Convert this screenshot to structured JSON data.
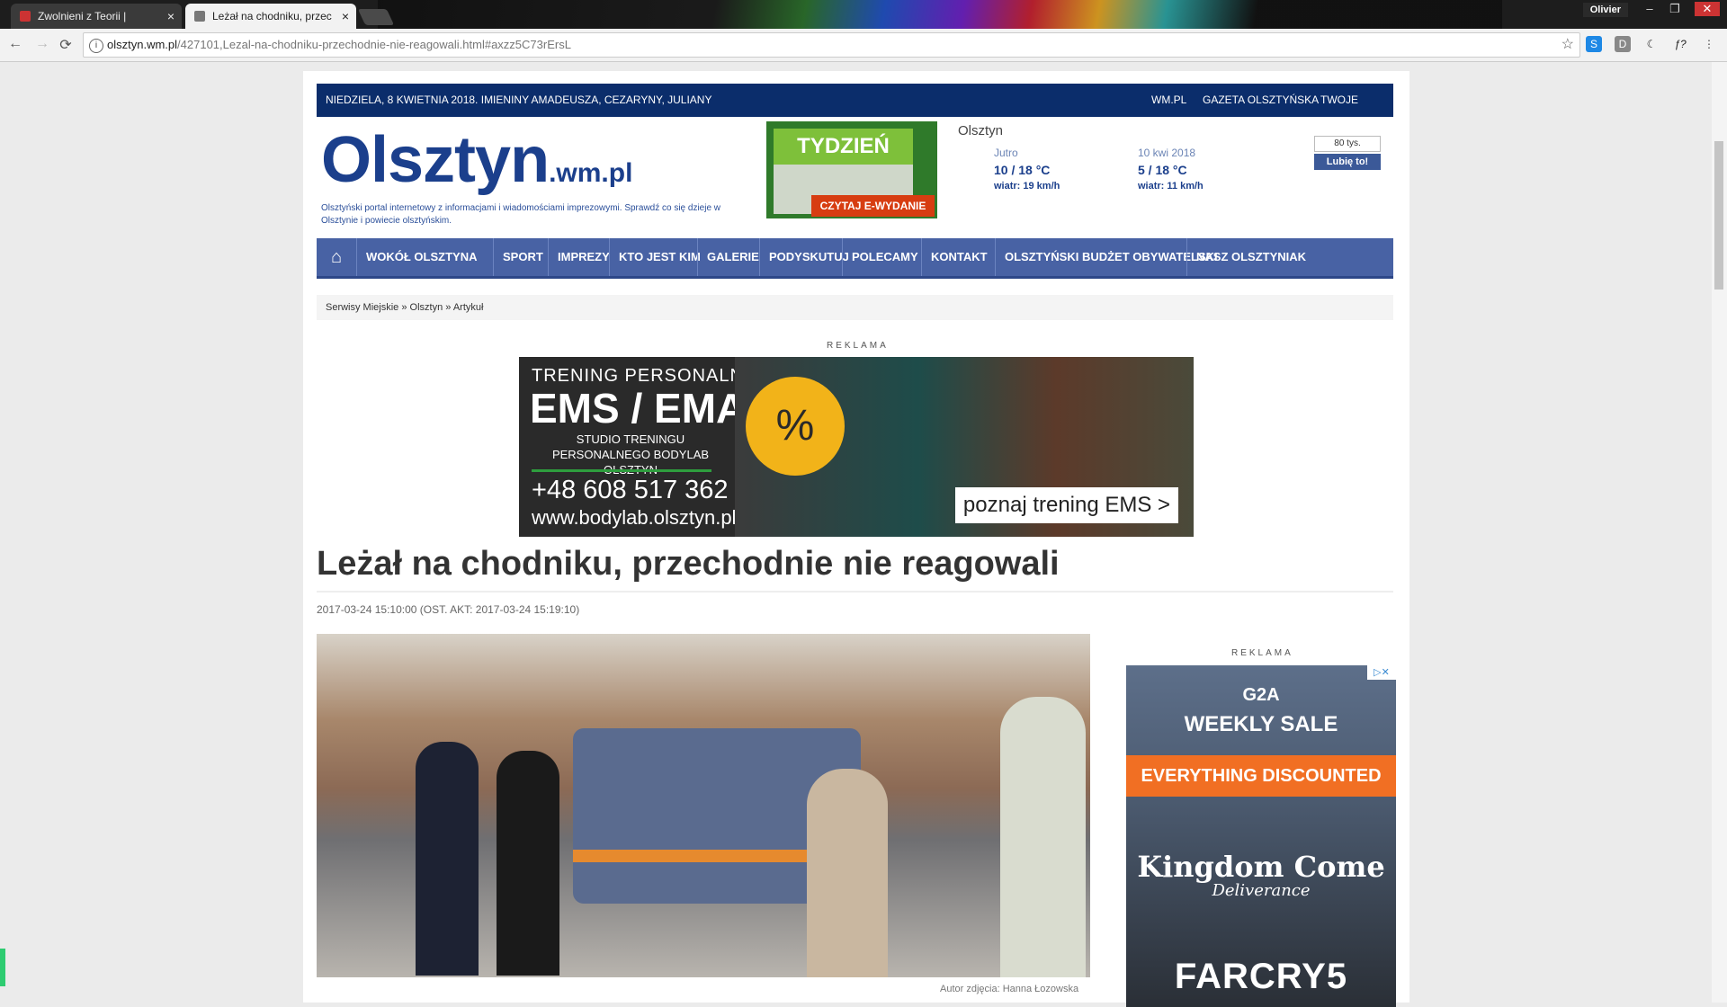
{
  "browser": {
    "tabs": [
      {
        "title": "Zwolnieni z Teorii |",
        "close": "×"
      },
      {
        "title": "Leżał na chodniku, przec",
        "close": "×"
      }
    ],
    "user": "Olivier",
    "window_controls": [
      "–",
      "❐",
      "✕"
    ],
    "url_host": "olsztyn.wm.pl",
    "url_path": "/427101,Lezal-na-chodniku-przechodnie-nie-reagowali.html#axzz5C73rErsL",
    "info_icon": "i",
    "back": "←",
    "forward": "→",
    "reload": "⟳",
    "star": "☆",
    "extensions": [
      "S",
      "D",
      "☾",
      "ƒ?",
      "⋮"
    ]
  },
  "site": {
    "date_line": "NIEDZIELA, 8 KWIETNIA 2018. IMIENINY AMADEUSZA, CEZARYNY, JULIANY",
    "top_links": [
      "WM.PL",
      "GAZETA OLSZTYŃSKA",
      "TWOJE KONTO"
    ],
    "logo_main": "Olsztyn",
    "logo_suffix": ".wm.pl",
    "tagline": "Olsztyński portal internetowy z informacjami i wiadomościami imprezowymi. Sprawdź co się dzieje w Olsztynie i powiecie olsztyńskim.",
    "promo": {
      "title": "TYDZIEŃ",
      "button": "CZYTAJ E-WYDANIE"
    },
    "weather": {
      "city": "Olsztyn",
      "days": [
        {
          "day": "Jutro",
          "temp": "10 / 18 °C",
          "wind": "wiatr: 19 km/h"
        },
        {
          "day": "10 kwi 2018",
          "temp": "5 / 18 °C",
          "wind": "wiatr: 11 km/h"
        }
      ]
    },
    "fb": {
      "count": "80 tys.",
      "like": "Lubię to!"
    },
    "menu": [
      "WOKÓŁ OLSZTYNA",
      "SPORT",
      "IMPREZY",
      "KTO JEST KIM",
      "GALERIE",
      "PODYSKUTUJ",
      "POLECAMY",
      "KONTAKT",
      "OLSZTYŃSKI BUDŻET OBYWATELSKI",
      "NASZ OLSZTYNIAK"
    ],
    "home_icon": "⌂",
    "breadcrumbs": "Serwisy Miejskie » Olsztyn » Artykuł"
  },
  "ads": {
    "label": "REKLAMA",
    "top": {
      "line1": "TRENING PERSONALNY",
      "line2": "EMS / EMA",
      "line3": "STUDIO TRENINGU PERSONALNEGO BODYLAB OLSZTYN",
      "phone": "+48 608 517 362",
      "www": "www.bodylab.olsztyn.pl",
      "badge": "%",
      "cta": "poznaj trening EMS >"
    },
    "side": {
      "brand": "G2A",
      "weekly": "WEEKLY SALE",
      "discount": "EVERYTHING DISCOUNTED",
      "game1": "Kingdom Come",
      "game1b": "Deliverance",
      "game2": "FARCRY5",
      "adchoice": "▷✕"
    }
  },
  "article": {
    "title": "Leżał na chodniku, przechodnie nie reagowali",
    "meta": "2017-03-24 15:10:00 (OST. AKT: 2017-03-24 15:19:10)",
    "photo_caption": "Autor zdjęcia: Hanna Łozowska"
  }
}
